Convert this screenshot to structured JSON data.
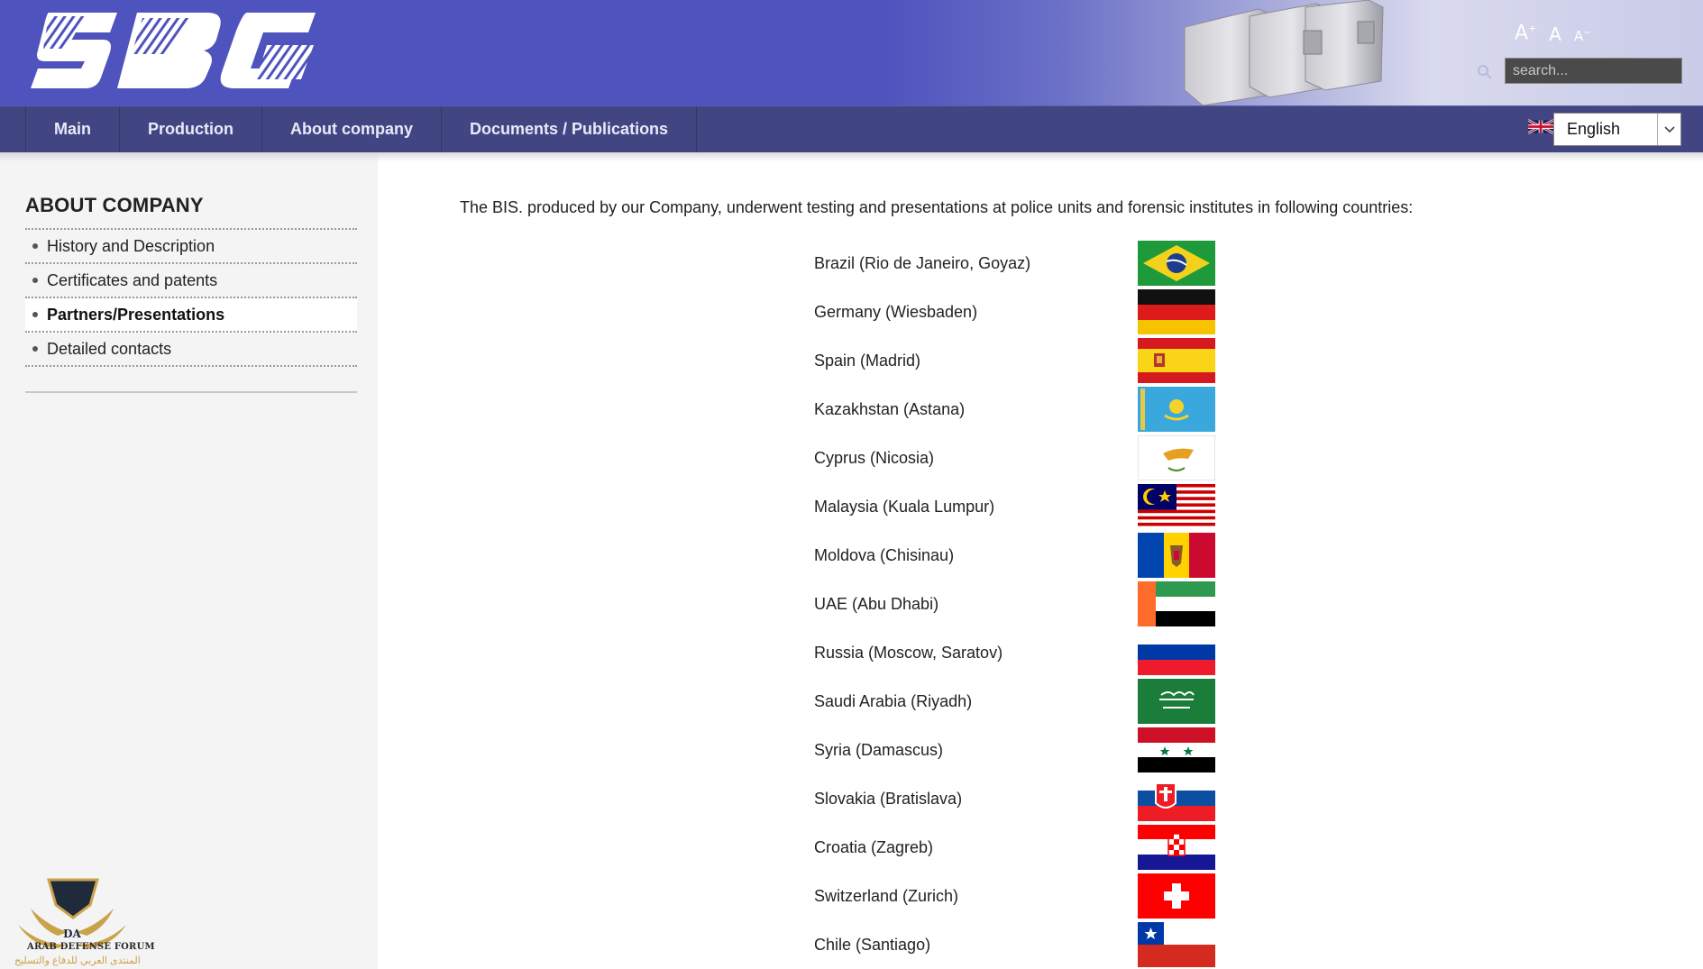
{
  "header": {
    "logo_text": "SBC",
    "font_size_controls": {
      "increase": "A",
      "normal": "A",
      "decrease": "A"
    },
    "search": {
      "placeholder": "search..."
    }
  },
  "nav": {
    "items": [
      {
        "label": "Main"
      },
      {
        "label": "Production"
      },
      {
        "label": "About company"
      },
      {
        "label": "Documents / Publications"
      }
    ],
    "language": {
      "selected": "English",
      "flag_icon": "uk-flag-icon"
    }
  },
  "sidebar": {
    "title": "ABOUT COMPANY",
    "items": [
      {
        "label": "History and Description"
      },
      {
        "label": "Certificates and patents"
      },
      {
        "label": "Partners/Presentations"
      },
      {
        "label": "Detailed contacts"
      }
    ],
    "active_index": 2
  },
  "main": {
    "intro": "The BIS. produced by our Company, underwent testing and presentations at police units and forensic institutes in following countries:",
    "countries": [
      {
        "name": "Brazil (Rio de Janeiro, Goyaz)",
        "flag": "brazil-flag-icon"
      },
      {
        "name": "Germany (Wiesbaden)",
        "flag": "germany-flag-icon"
      },
      {
        "name": "Spain (Madrid)",
        "flag": "spain-flag-icon"
      },
      {
        "name": "Kazakhstan (Astana)",
        "flag": "kazakhstan-flag-icon"
      },
      {
        "name": "Cyprus (Nicosia)",
        "flag": "cyprus-flag-icon"
      },
      {
        "name": "Malaysia (Kuala Lumpur)",
        "flag": "malaysia-flag-icon"
      },
      {
        "name": "Moldova (Chisinau)",
        "flag": "moldova-flag-icon"
      },
      {
        "name": "UAE (Abu Dhabi)",
        "flag": "uae-flag-icon"
      },
      {
        "name": "Russia (Moscow, Saratov)",
        "flag": "russia-flag-icon"
      },
      {
        "name": "Saudi Arabia (Riyadh)",
        "flag": "saudi-arabia-flag-icon"
      },
      {
        "name": "Syria (Damascus)",
        "flag": "syria-flag-icon"
      },
      {
        "name": "Slovakia (Bratislava)",
        "flag": "slovakia-flag-icon"
      },
      {
        "name": "Croatia (Zagreb)",
        "flag": "croatia-flag-icon"
      },
      {
        "name": "Switzerland (Zurich)",
        "flag": "switzerland-flag-icon"
      },
      {
        "name": "Chile (Santiago)",
        "flag": "chile-flag-icon"
      }
    ]
  },
  "watermark": {
    "text_en": "ARAB DEFENSE FORUM",
    "text_ar": "المنتدى العربي للدفاع والتسليح",
    "mark": "DA"
  },
  "colors": {
    "header_blue": "#4f53bd",
    "nav_blue": "#414683",
    "sidebar_bg": "#f4f4f4"
  }
}
